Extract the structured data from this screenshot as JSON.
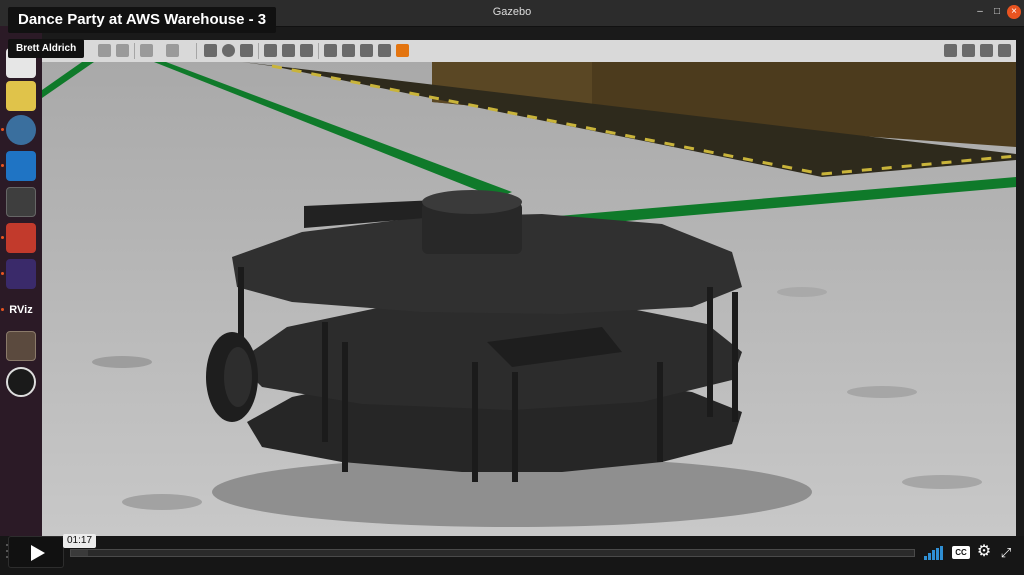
{
  "window": {
    "title": "Gazebo",
    "controls": {
      "minimize": "–",
      "maximize": "□",
      "close": "×"
    }
  },
  "video": {
    "title": "Dance Party at AWS Warehouse - 3",
    "byline": "Brett Aldrich",
    "current_time": "01:17",
    "progress_fraction": 0.02,
    "cc_label": "CC",
    "settings_icon": "⚙",
    "fullscreen_icon": "⤢"
  },
  "dock": {
    "apps": [
      "files-icon",
      "gimp-icon",
      "gazebo-icon",
      "vscode-icon",
      "system-monitor-icon",
      "screenshot-icon",
      "xterm-icon",
      "rviz-icon",
      "books-icon",
      "obs-icon"
    ],
    "rviz_label": "RViz"
  },
  "colors": {
    "accent": "#e95420",
    "volume": "#2f8fd4",
    "floor": "#bdbdbd",
    "lane_line": "#0f7a2a",
    "warehouse_wall": "#4c3b1d",
    "robot": "#2c2c2c"
  }
}
